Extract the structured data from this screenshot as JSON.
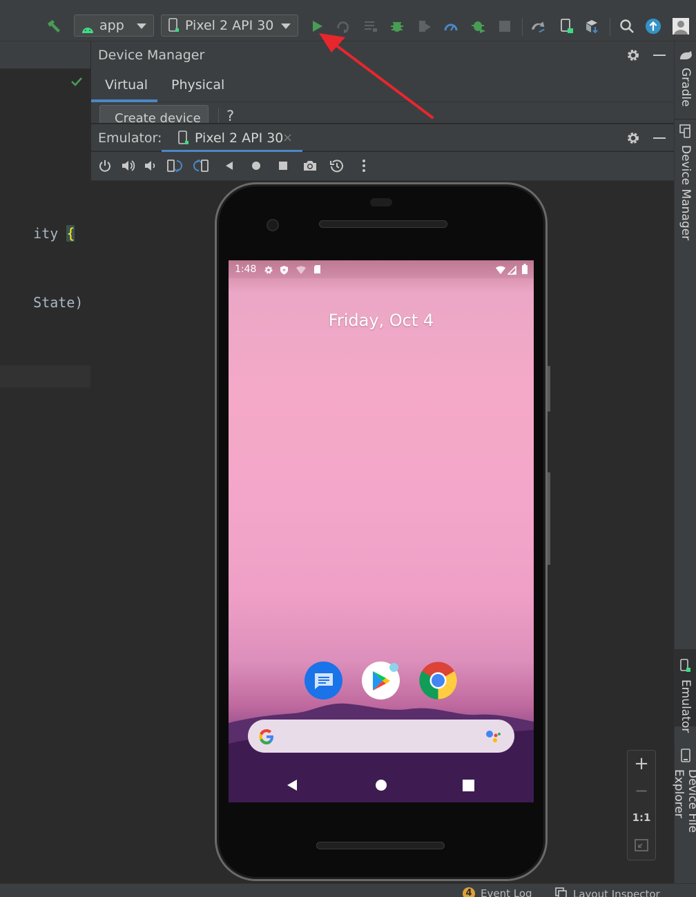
{
  "toolbar": {
    "run_config": "app",
    "device_selector": "Pixel 2 API 30"
  },
  "editor": {
    "line1": "ity ",
    "line1_brace": "{",
    "line2": "State) {"
  },
  "device_manager": {
    "title": "Device Manager",
    "tabs": [
      {
        "label": "Virtual"
      },
      {
        "label": "Physical"
      }
    ],
    "create_device": "Create device",
    "help": "?"
  },
  "emulator": {
    "label": "Emulator:",
    "device_tab": "Pixel 2 API 30",
    "close": "×"
  },
  "phone": {
    "time": "1:48",
    "date": "Friday, Oct 4"
  },
  "zoom": {
    "plus": "+",
    "minus": "−",
    "one_to_one": "1:1"
  },
  "right_sidebar": {
    "tabs": [
      {
        "label": "Gradle"
      },
      {
        "label": "Device Manager"
      },
      {
        "label": "Emulator"
      },
      {
        "label": "Device File Explorer"
      }
    ]
  },
  "statusbar": {
    "event_log_count": "4",
    "event_log": "Event Log",
    "layout_inspector": "Layout Inspector"
  },
  "colors": {
    "accent_blue": "#4a88c7",
    "run_green": "#499c54",
    "annotation_red": "#e8262d"
  }
}
